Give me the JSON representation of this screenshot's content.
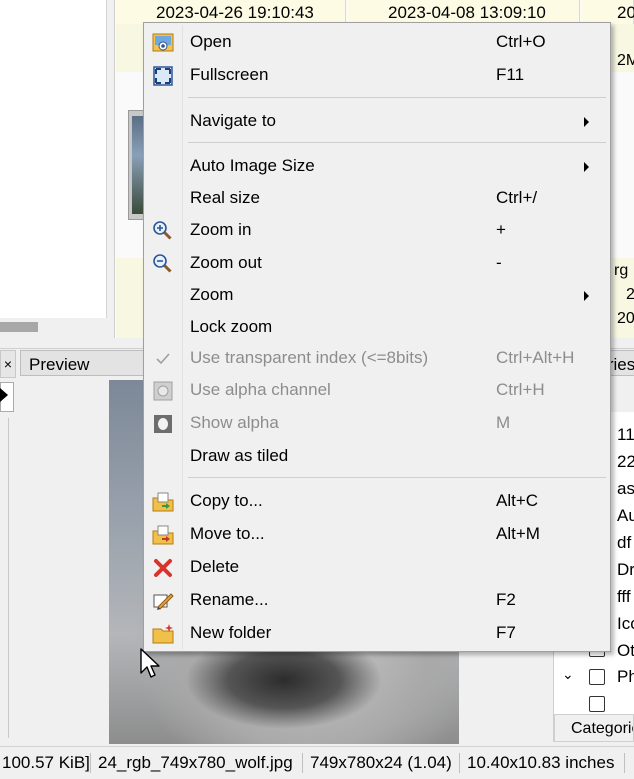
{
  "thumbnails": {
    "dates": [
      "2023-04-26 19:10:43",
      "2023-04-08 13:09:10",
      "20"
    ],
    "edge_texts": [
      "2M",
      "rg",
      "2",
      "20"
    ]
  },
  "panels": {
    "close_glyph": "×",
    "preview_tab": "Preview",
    "right_tab": "Categories",
    "categories_tab": "Categories"
  },
  "categories": [
    "11",
    "22",
    "as",
    "Au",
    "df",
    "Dr",
    "fff",
    "Ico",
    "Ot",
    "Ph"
  ],
  "statusbar": {
    "size": "100.57 KiB]",
    "filename": "24_rgb_749x780_wolf.jpg",
    "dims": "749x780x24 (1.04)",
    "print_size": "10.40x10.83 inches"
  },
  "menu": {
    "items": [
      {
        "label": "Open",
        "shortcut": "Ctrl+O",
        "icon": "open-image-icon"
      },
      {
        "label": "Fullscreen",
        "shortcut": "F11",
        "icon": "fullscreen-icon"
      },
      {
        "label": "Navigate to",
        "shortcut": "",
        "submenu": true
      },
      {
        "label": "Auto Image Size",
        "shortcut": "",
        "submenu": true
      },
      {
        "label": "Real size",
        "shortcut": "Ctrl+/"
      },
      {
        "label": "Zoom in",
        "shortcut": "+",
        "icon": "zoom-in-icon"
      },
      {
        "label": "Zoom out",
        "shortcut": "-",
        "icon": "zoom-out-icon"
      },
      {
        "label": "Zoom",
        "shortcut": "",
        "submenu": true
      },
      {
        "label": "Lock zoom",
        "shortcut": ""
      },
      {
        "label": "Use transparent index (<=8bits)",
        "shortcut": "Ctrl+Alt+H",
        "disabled": true,
        "icon": "checkmark-icon"
      },
      {
        "label": "Use alpha channel",
        "shortcut": "Ctrl+H",
        "disabled": true,
        "icon": "alpha-channel-icon"
      },
      {
        "label": "Show alpha",
        "shortcut": "M",
        "disabled": true,
        "icon": "show-alpha-icon"
      },
      {
        "label": "Draw as tiled",
        "shortcut": ""
      },
      {
        "label": "Copy to...",
        "shortcut": "Alt+C",
        "icon": "copy-to-folder-icon"
      },
      {
        "label": "Move to...",
        "shortcut": "Alt+M",
        "icon": "move-to-folder-icon"
      },
      {
        "label": "Delete",
        "shortcut": "",
        "icon": "delete-x-icon"
      },
      {
        "label": "Rename...",
        "shortcut": "F2",
        "icon": "rename-pencil-icon"
      },
      {
        "label": "New folder",
        "shortcut": "F7",
        "icon": "new-folder-icon"
      }
    ]
  },
  "colors": {
    "menu_bg": "#f0f0f0",
    "disabled_text": "#8d8d8d",
    "thumb_header_bg": "#fdfbe4",
    "delete_red": "#d9342b"
  }
}
